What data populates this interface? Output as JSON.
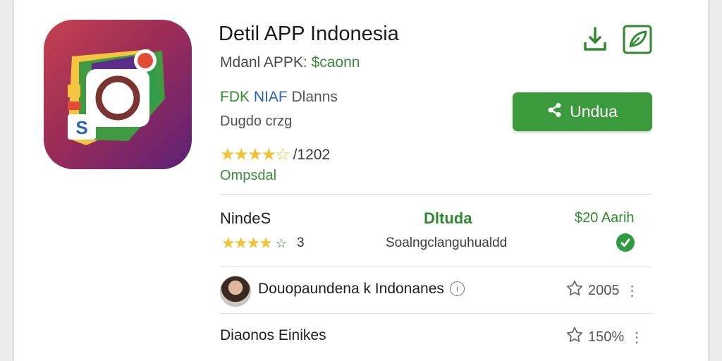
{
  "app": {
    "title": "Detil APP Indonesia",
    "subtitle_prefix": "Mdanl APPK: ",
    "subtitle_accent": "$caonn",
    "developer_g": "FDK",
    "developer_b": " NIAF",
    "developer_n": " Dlanns",
    "category": "Dugdo crzg",
    "rating_stars": "★★★★☆",
    "rating_value": 4.5,
    "rating_count": "/1202",
    "status": "Ompsdal"
  },
  "actions": {
    "install_icon": "install-hand-icon",
    "share_icon": "leaf-share-icon",
    "download_label": "Undua"
  },
  "stats": {
    "name": "NindeS",
    "stars": "★★★★",
    "star_extra": "☆",
    "count": "3",
    "mid_label": "Dltuda",
    "languages": "Soalngclanguhualdd",
    "price": "$20 Aarih"
  },
  "reviews": [
    {
      "text": "Douopaundena k Indonanes",
      "rating": "2005"
    },
    {
      "text": "Diaonos Einikes",
      "rating": "150%"
    }
  ],
  "colors": {
    "brand_green": "#3b9a3b",
    "star": "#f1c232",
    "dev_blue": "#2c62b8"
  }
}
